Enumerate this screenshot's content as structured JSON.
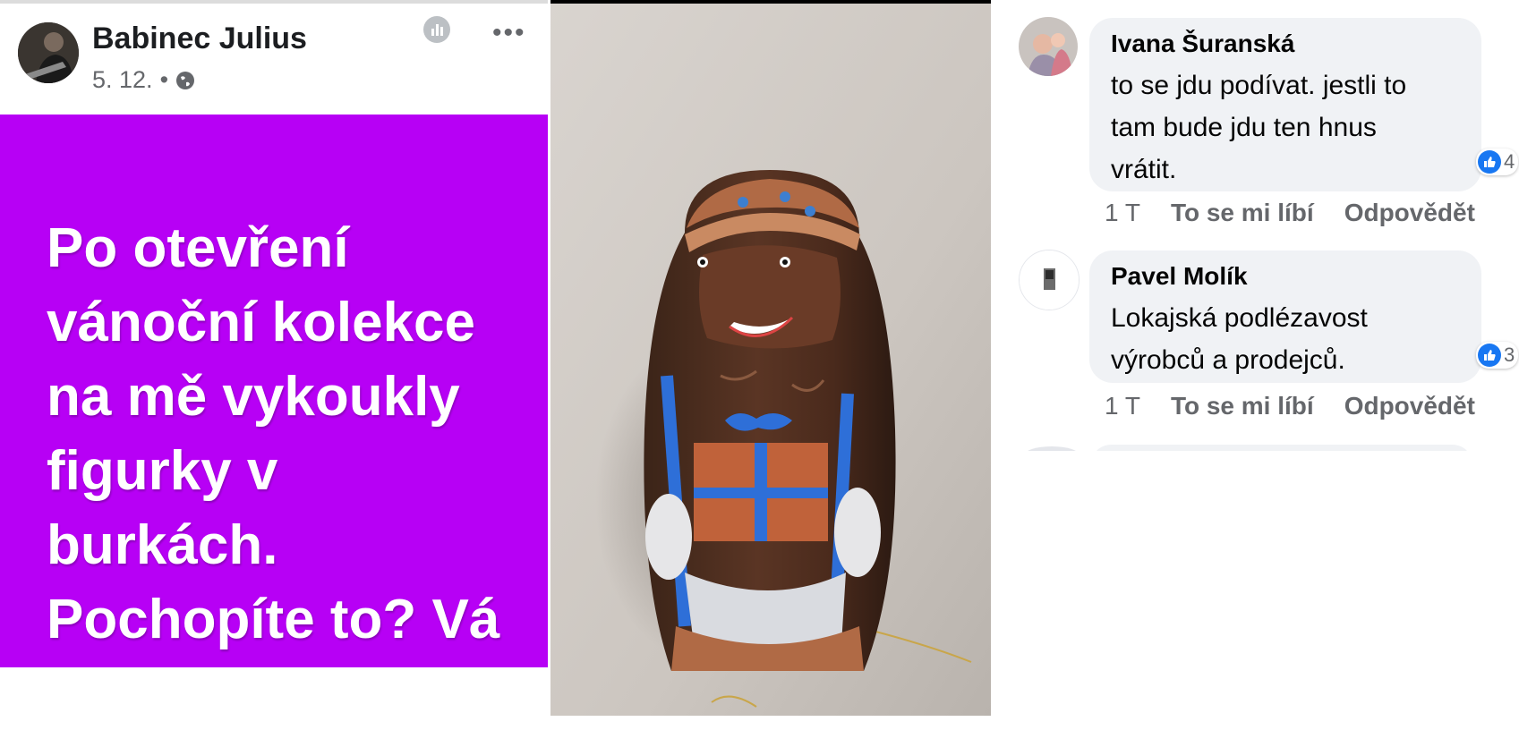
{
  "post": {
    "author": "Babinec Julius",
    "date": "5. 12.",
    "separator": "•",
    "privacy_icon": "globe-icon",
    "more_label": "•••",
    "text": "Po otevření vánoční kolekce na mě vykoukly figurky v burkách. Pochopíte to? Vá",
    "background_color": "#b700f5"
  },
  "photo": {
    "subject": "chocolate-figure-photo"
  },
  "comments": [
    {
      "author": "Ivana Šuranská",
      "text_lines": [
        "to se jdu podívat. jestli to",
        "tam bude jdu ten hnus",
        "vrátit."
      ],
      "reactions": "4",
      "time": "1 T",
      "like_label": "To se mi líbí",
      "reply_label": "Odpovědět"
    },
    {
      "author": "Pavel Molík",
      "text_lines": [
        "Lokajská podlézavost",
        "výrobců a prodejců."
      ],
      "reactions": "3",
      "time": "1 T",
      "like_label": "To se mi líbí",
      "reply_label": "Odpovědět"
    }
  ],
  "colors": {
    "accent": "#1877f2",
    "bubble": "#f0f2f5",
    "muted_text": "#65676b"
  }
}
